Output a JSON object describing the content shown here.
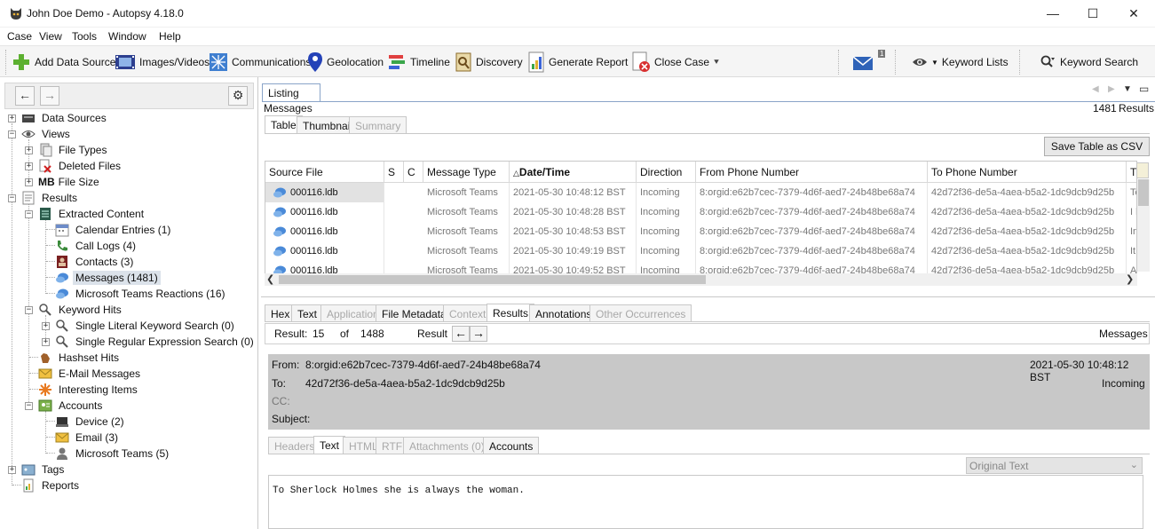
{
  "window": {
    "title": "John Doe Demo - Autopsy 4.18.0",
    "minimize": "—",
    "maximize": "☐",
    "close": "✕"
  },
  "menu": [
    "Case",
    "View",
    "Tools",
    "Window",
    "Help"
  ],
  "toolbar": {
    "add_data_source": "Add Data Source",
    "images_videos": "Images/Videos",
    "communications": "Communications",
    "geolocation": "Geolocation",
    "timeline": "Timeline",
    "discovery": "Discovery",
    "generate_report": "Generate Report",
    "close_case": "Close Case",
    "mail_badge": "1",
    "keyword_lists": "Keyword Lists",
    "keyword_search": "Keyword Search"
  },
  "tree": {
    "data_sources": "Data Sources",
    "views": "Views",
    "file_types": "File Types",
    "deleted_files": "Deleted Files",
    "file_size_prefix": "MB",
    "file_size": "File Size",
    "results": "Results",
    "extracted_content": "Extracted Content",
    "calendar_entries": "Calendar Entries (1)",
    "call_logs": "Call Logs (4)",
    "contacts": "Contacts (3)",
    "messages": "Messages (1481)",
    "teams_reactions": "Microsoft Teams Reactions (16)",
    "keyword_hits": "Keyword Hits",
    "single_literal": "Single Literal Keyword Search (0)",
    "single_regex": "Single Regular Expression Search (0)",
    "hashset_hits": "Hashset Hits",
    "email_messages": "E-Mail Messages",
    "interesting_items": "Interesting Items",
    "accounts": "Accounts",
    "device": "Device (2)",
    "email": "Email (3)",
    "microsoft_teams": "Microsoft Teams (5)",
    "tags": "Tags",
    "reports": "Reports"
  },
  "listing": {
    "tab": "Listing",
    "section": "Messages",
    "count": "1481",
    "count_label": "Results",
    "subtabs": [
      "Table",
      "Thumbnail",
      "Summary"
    ],
    "save_csv": "Save Table as CSV",
    "columns": [
      "Source File",
      "S",
      "C",
      "Message Type",
      "Date/Time",
      "Direction",
      "From Phone Number",
      "To Phone Number",
      "T"
    ],
    "rows": [
      {
        "file": "000116.ldb",
        "type": "Microsoft Teams",
        "date": "2021-05-30 10:48:12 BST",
        "dir": "Incoming",
        "from": "8:orgid:e62b7cec-7379-4d6f-aed7-24b48be68a74",
        "to": "42d72f36-de5a-4aea-b5a2-1dc9dcb9d25b",
        "t": "To"
      },
      {
        "file": "000116.ldb",
        "type": "Microsoft Teams",
        "date": "2021-05-30 10:48:28 BST",
        "dir": "Incoming",
        "from": "8:orgid:e62b7cec-7379-4d6f-aed7-24b48be68a74",
        "to": "42d72f36-de5a-4aea-b5a2-1dc9dcb9d25b",
        "t": "I h"
      },
      {
        "file": "000116.ldb",
        "type": "Microsoft Teams",
        "date": "2021-05-30 10:48:53 BST",
        "dir": "Incoming",
        "from": "8:orgid:e62b7cec-7379-4d6f-aed7-24b48be68a74",
        "to": "42d72f36-de5a-4aea-b5a2-1dc9dcb9d25b",
        "t": "In"
      },
      {
        "file": "000116.ldb",
        "type": "Microsoft Teams",
        "date": "2021-05-30 10:49:19 BST",
        "dir": "Incoming",
        "from": "8:orgid:e62b7cec-7379-4d6f-aed7-24b48be68a74",
        "to": "42d72f36-de5a-4aea-b5a2-1dc9dcb9d25b",
        "t": "It"
      },
      {
        "file": "000116.ldb",
        "type": "Microsoft Teams",
        "date": "2021-05-30 10:49:52 BST",
        "dir": "Incoming",
        "from": "8:orgid:e62b7cec-7379-4d6f-aed7-24b48be68a74",
        "to": "42d72f36-de5a-4aea-b5a2-1dc9dcb9d25b",
        "t": "Al"
      }
    ]
  },
  "viewer": {
    "tabs": [
      "Hex",
      "Text",
      "Application",
      "File Metadata",
      "Context",
      "Results",
      "Annotations",
      "Other Occurrences"
    ],
    "result_label": "Result:",
    "result_current": "15",
    "result_of": "of",
    "result_total": "1488",
    "result_nav_label": "Result",
    "type_label": "Messages",
    "from_label": "From:",
    "from_value": "8:orgid:e62b7cec-7379-4d6f-aed7-24b48be68a74",
    "to_label": "To:",
    "to_value": "42d72f36-de5a-4aea-b5a2-1dc9dcb9d25b",
    "cc_label": "CC:",
    "subject_label": "Subject:",
    "datetime": "2021-05-30 10:48:12 BST",
    "direction": "Incoming",
    "msg_tabs": [
      "Headers",
      "Text",
      "HTML",
      "RTF",
      "Attachments (0)",
      "Accounts"
    ],
    "text_mode": "Original Text",
    "body": "To Sherlock Holmes she is always the woman."
  }
}
